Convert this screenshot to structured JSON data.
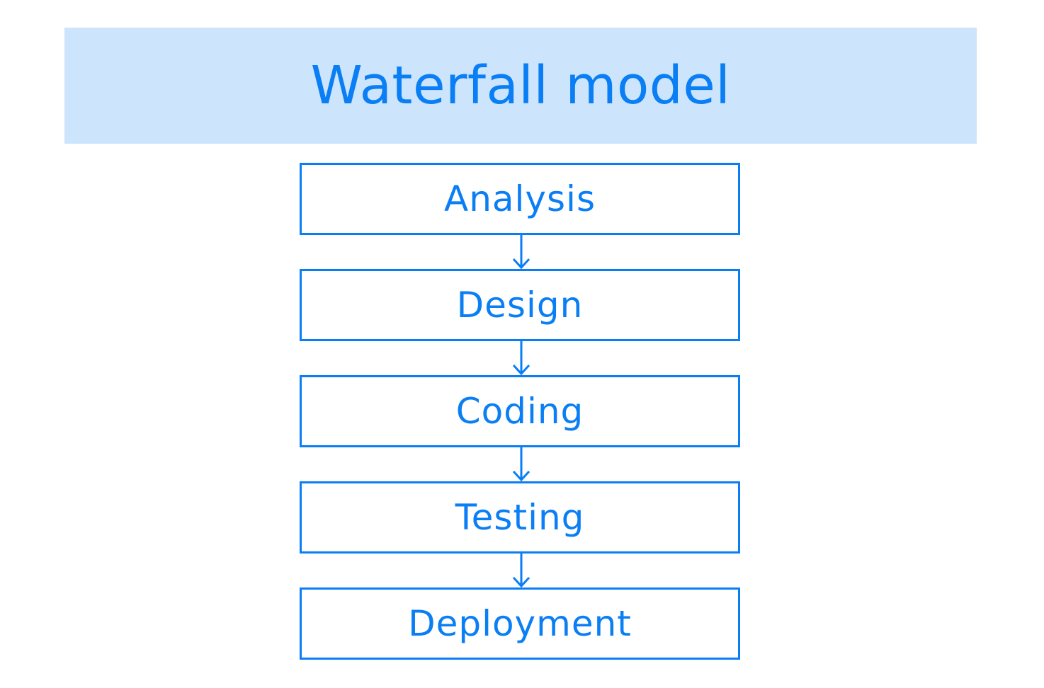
{
  "title": "Waterfall model",
  "steps": [
    {
      "label": "Analysis"
    },
    {
      "label": "Design"
    },
    {
      "label": "Coding"
    },
    {
      "label": "Testing"
    },
    {
      "label": "Deployment"
    }
  ],
  "colors": {
    "accent": "#0a7ef4",
    "banner": "#cce5fc",
    "background": "#ffffff"
  }
}
